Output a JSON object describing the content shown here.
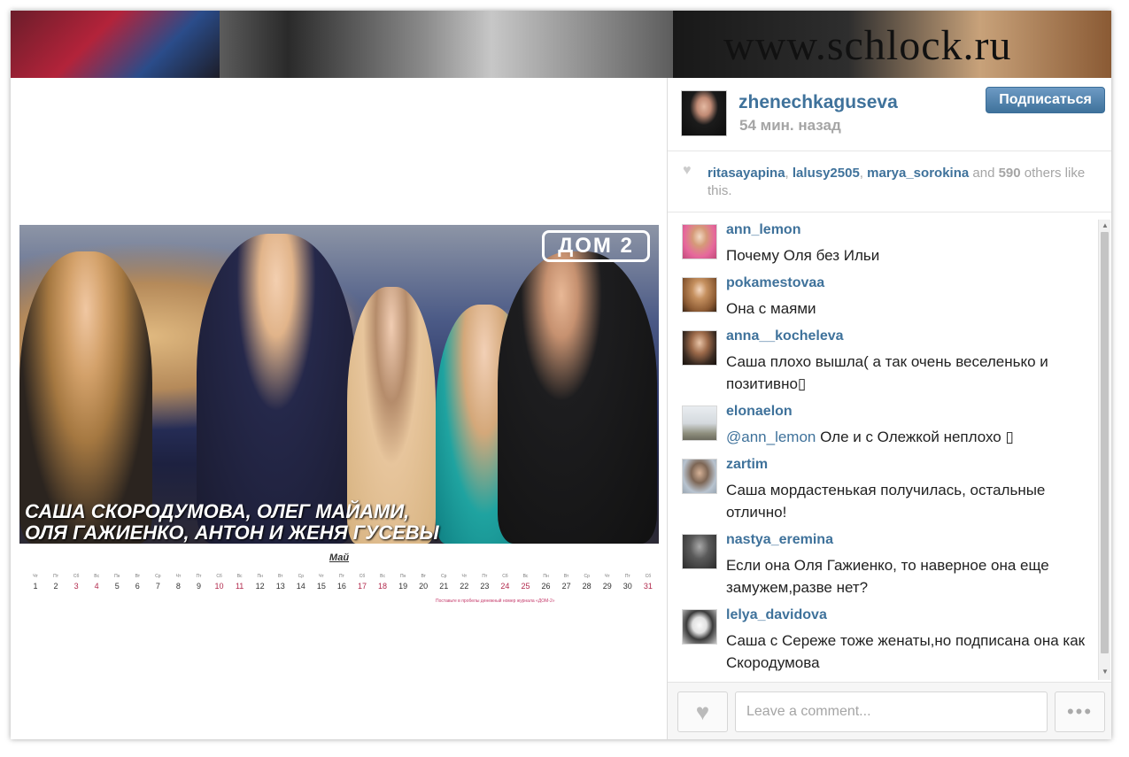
{
  "watermark": "www.schlock.ru",
  "post": {
    "username": "zhenechkaguseva",
    "time": "54 мин. назад",
    "follow_label": "Подписаться"
  },
  "photo": {
    "logo": "ДОМ 2",
    "caption_line1": "САША СКОРОДУМОВА, ОЛЕГ МАЙАМИ,",
    "caption_line2": "ОЛЯ ГАЖИЕНКО, АНТОН И ЖЕНЯ ГУСЕВЫ",
    "month": "Май",
    "footnote": "Поставьте в пробелы денежный номер журнала «ДОМ-2»",
    "days": [
      {
        "wd": "Чт",
        "n": "1"
      },
      {
        "wd": "Пт",
        "n": "2"
      },
      {
        "wd": "Сб",
        "n": "3"
      },
      {
        "wd": "Вс",
        "n": "4"
      },
      {
        "wd": "Пн",
        "n": "5"
      },
      {
        "wd": "Вт",
        "n": "6"
      },
      {
        "wd": "Ср",
        "n": "7"
      },
      {
        "wd": "Чт",
        "n": "8"
      },
      {
        "wd": "Пт",
        "n": "9"
      },
      {
        "wd": "Сб",
        "n": "10"
      },
      {
        "wd": "Вс",
        "n": "11"
      },
      {
        "wd": "Пн",
        "n": "12"
      },
      {
        "wd": "Вт",
        "n": "13"
      },
      {
        "wd": "Ср",
        "n": "14"
      },
      {
        "wd": "Чт",
        "n": "15"
      },
      {
        "wd": "Пт",
        "n": "16"
      },
      {
        "wd": "Сб",
        "n": "17"
      },
      {
        "wd": "Вс",
        "n": "18"
      },
      {
        "wd": "Пн",
        "n": "19"
      },
      {
        "wd": "Вт",
        "n": "20"
      },
      {
        "wd": "Ср",
        "n": "21"
      },
      {
        "wd": "Чт",
        "n": "22"
      },
      {
        "wd": "Пт",
        "n": "23"
      },
      {
        "wd": "Сб",
        "n": "24"
      },
      {
        "wd": "Вс",
        "n": "25"
      },
      {
        "wd": "Пн",
        "n": "26"
      },
      {
        "wd": "Вт",
        "n": "27"
      },
      {
        "wd": "Ср",
        "n": "28"
      },
      {
        "wd": "Чт",
        "n": "29"
      },
      {
        "wd": "Пт",
        "n": "30"
      },
      {
        "wd": "Сб",
        "n": "31"
      }
    ],
    "red_days": [
      "3",
      "4",
      "10",
      "11",
      "17",
      "18",
      "24",
      "25",
      "31"
    ]
  },
  "likes": {
    "users": [
      "ritasayapina",
      "lalusy2505",
      "marya_sorokina"
    ],
    "sep": ", ",
    "and": " and ",
    "count": "590",
    "suffix": " others like this."
  },
  "comments": [
    {
      "user": "ann_lemon",
      "text": "Почему Оля без Ильи",
      "mention": ""
    },
    {
      "user": "pokamestovaa",
      "text": "Она с маями",
      "mention": ""
    },
    {
      "user": "anna__kocheleva",
      "text": "Саша плохо вышла( а так очень веселенько и позитивно▯",
      "mention": ""
    },
    {
      "user": "elonaelon",
      "text": " Оле и с Олежкой неплохо ▯",
      "mention": "@ann_lemon"
    },
    {
      "user": "zartim",
      "text": "Саша мордастенькая получилась, остальные отлично!",
      "mention": ""
    },
    {
      "user": "nastya_eremina",
      "text": "Если она Оля Гажиенко, то наверное она еще замужем,разве нет?",
      "mention": ""
    },
    {
      "user": "lelya_davidova",
      "text": "Саша с Сереже тоже женаты,но подписана она как Скородумова",
      "mention": ""
    }
  ],
  "comment_input": {
    "placeholder": "Leave a comment..."
  },
  "icons": {
    "like": "heart-icon",
    "more": "more-dots-icon"
  },
  "colors": {
    "link": "#3f729b",
    "muted": "#a5a5a5",
    "follow_bg": "#3f729b"
  }
}
